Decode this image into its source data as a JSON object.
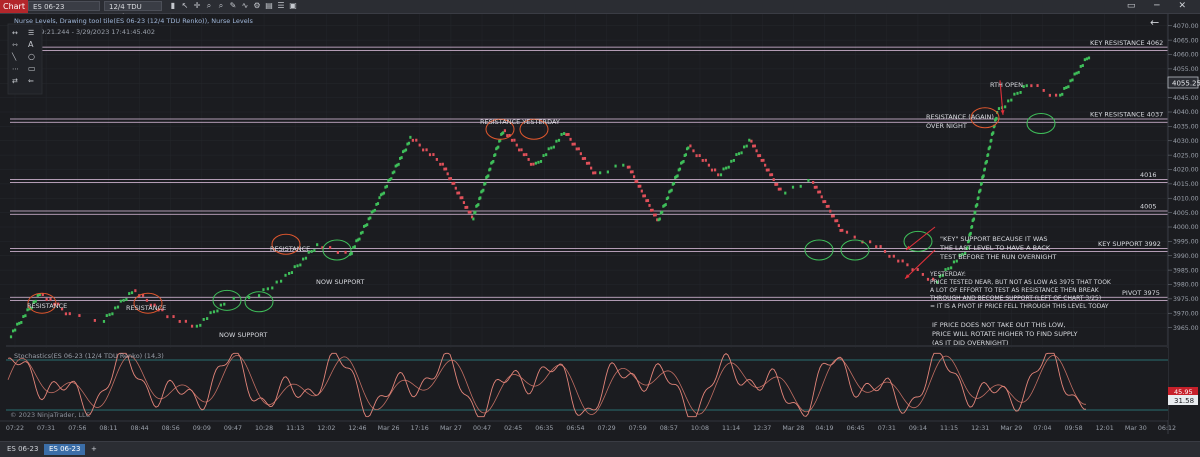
{
  "app": {
    "tab": "Chart",
    "instrument": "ES 06-23",
    "bar_type": "12/4 TDU Renko"
  },
  "window": {
    "controls": "▭ ─ ✕"
  },
  "chart_info": {
    "title": "Nurse Levels, Drawing tool tile(ES 06-23 (12/4 TDU Renko)), Nurse Levels",
    "range": "7:19:21.244 - 3/29/2023 17:41:45.402",
    "back_arrow": "←"
  },
  "drawing_tools": [
    "line",
    "ray",
    "text",
    "extended",
    "circle",
    "dash-line",
    "rect",
    "arrow",
    "undo"
  ],
  "price_axis": {
    "labels": [
      "4070.00",
      "4065.00",
      "4060.00",
      "4055.00",
      "4050.00",
      "4045.00",
      "4040.00",
      "4035.00",
      "4030.00",
      "4025.00",
      "4020.00",
      "4015.00",
      "4010.00",
      "4005.00",
      "4000.00",
      "3995.00",
      "3990.00",
      "3985.00",
      "3980.00",
      "3975.00",
      "3970.00",
      "3965.00"
    ],
    "current_price": "4055.25"
  },
  "levels": [
    {
      "label": "KEY RESISTANCE 4062",
      "price": 4062
    },
    {
      "label": "KEY RESISTANCE 4037",
      "price": 4037
    },
    {
      "label": "4016",
      "price": 4016
    },
    {
      "label": "4005",
      "price": 4005
    },
    {
      "label": "KEY SUPPORT 3992",
      "price": 3992
    },
    {
      "label": "PIVOT 3975",
      "price": 3975
    }
  ],
  "annotations": {
    "resistance_1": "RESISTANCE",
    "resistance_2": "RESISTANCE",
    "resistance_3": "RESISTANCE",
    "now_support_1": "NOW SUPPORT",
    "now_support_2": "NOW SUPPORT",
    "resistance_yesterday": "RESISTANCE YESTERDAY",
    "rth_open": "RTH OPEN",
    "resistance_again_1": "RESISTANCE (AGAIN)",
    "resistance_again_2": "OVER NIGHT",
    "key_support_note": [
      "\"KEY\" SUPPORT BECAUSE IT WAS",
      "THE LAST LEVEL TO HAVE A BACK",
      "TEST BEFORE THE RUN OVERNIGHT"
    ],
    "yesterday_note": [
      "YESTERDAY:",
      "PRICE TESTED NEAR, BUT NOT AS LOW AS 3975 THAT TOOK",
      "A LOT OF EFFORT TO TEST AS RESISTANCE THEN BREAK",
      "THROUGH AND BECOME SUPPORT (LEFT OF CHART 3/25)",
      "= IT IS A PIVOT IF PRICE FELL THROUGH THIS LEVEL TODAY"
    ],
    "low_note": [
      "IF PRICE DOES NOT TAKE OUT THIS LOW,",
      "PRICE WILL ROTATE HIGHER TO FIND SUPPLY",
      "(AS IT DID OVERNIGHT)"
    ]
  },
  "indicator": {
    "title": "Stochastics(ES 06-23 (12/4 TDU Renko) (14,3)",
    "label_a": "45.95",
    "label_b": "31.58",
    "copyright": "© 2023 NinjaTrader, LLC"
  },
  "time_axis": [
    "07:22",
    "07:31",
    "07:56",
    "08:11",
    "08:44",
    "08:56",
    "09:09",
    "09:47",
    "10:28",
    "11:13",
    "12:02",
    "12:46",
    "Mar 26",
    "17:16",
    "Mar 27",
    "00:47",
    "02:45",
    "06:35",
    "06:54",
    "07:29",
    "07:59",
    "08:57",
    "10:08",
    "11:14",
    "12:37",
    "Mar 28",
    "04:19",
    "06:45",
    "07:31",
    "09:14",
    "11:15",
    "12:31",
    "Mar 29",
    "07:04",
    "09:58",
    "12:01",
    "Mar 30",
    "06:12"
  ],
  "footer_tabs": [
    "ES 06-23",
    "ES 06-23"
  ],
  "footer_add": "+",
  "colors": {
    "up": "#3fbf5a",
    "down": "#e0505a",
    "level": "#e6c6e6",
    "circle_red": "#e0572e",
    "circle_green": "#3fbf5a",
    "stoch": "#e07a6e",
    "stoch_band": "#2f8a8a"
  },
  "chart_data": {
    "type": "line",
    "title": "",
    "series": [
      {
        "name": "",
        "x": [
          "07:22",
          "07:31",
          "07:56",
          "08:11",
          "08:44",
          "08:56",
          "09:09",
          "09:47",
          "10:28",
          "11:13",
          "12:02",
          "12:46",
          "Mar 26",
          "17:16",
          "Mar 27",
          "00:47",
          "02:45",
          "06:35",
          "06:54",
          "07:29",
          "07:59",
          "08:57",
          "10:08",
          "11:14",
          "12:37",
          "Mar 28",
          "04:19",
          "06:45",
          "07:31",
          "09:14",
          "11:15",
          "12:31",
          "Mar 29",
          "07:04",
          "09:58",
          "12:01"
        ],
        "values": [
          3962,
          3977,
          3969,
          3967,
          3978,
          3970,
          3965,
          3974,
          3976,
          3983,
          3994,
          3990,
          4010,
          4031,
          4022,
          4003,
          4034,
          4021,
          4033,
          4018,
          4022,
          4002,
          4028,
          4018,
          4030,
          4012,
          4016,
          3998,
          3994,
          3987,
          3981,
          3992,
          4040,
          4050,
          4045,
          4060
        ]
      }
    ],
    "ylim": [
      3960,
      4072
    ],
    "grid": true,
    "legend": "none"
  }
}
